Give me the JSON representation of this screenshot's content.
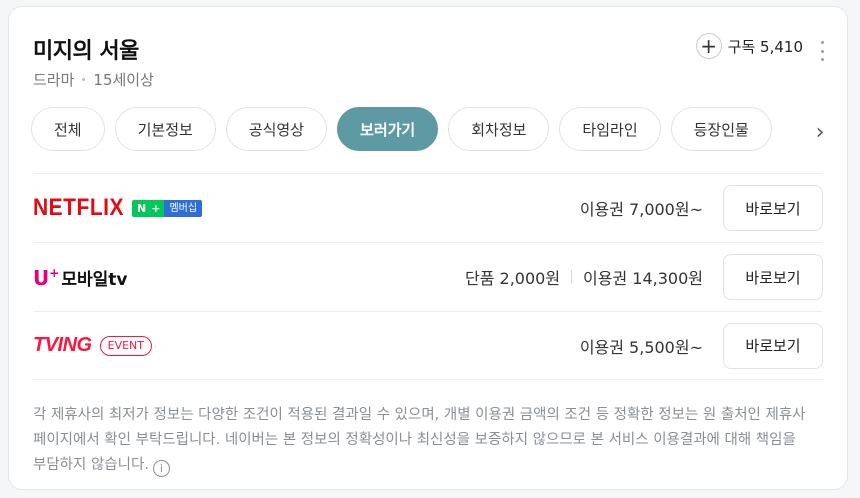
{
  "header": {
    "title": "미지의 서울",
    "genre": "드라마",
    "rating": "15세이상",
    "subscribe_label": "구독 5,410",
    "plus_glyph": "+"
  },
  "tabs": [
    {
      "label": "전체",
      "active": false
    },
    {
      "label": "기본정보",
      "active": false
    },
    {
      "label": "공식영상",
      "active": false
    },
    {
      "label": "보러가기",
      "active": true
    },
    {
      "label": "회차정보",
      "active": false
    },
    {
      "label": "타임라인",
      "active": false
    },
    {
      "label": "등장인물",
      "active": false
    }
  ],
  "providers": {
    "netflix": {
      "logo": "NETFLIX",
      "badge_n": "N",
      "badge_plus": "+",
      "badge_member": "멤버십",
      "price": "이용권 7,000원~",
      "button": "바로보기",
      "color": "#e50914"
    },
    "uplus": {
      "logo_u": "U",
      "logo_sup": "+",
      "logo_text": "모바일tv",
      "price_single": "단품 2,000원",
      "price_pass": "이용권 14,300원",
      "button": "바로보기",
      "color": "#e6007e"
    },
    "tving": {
      "logo": "TVING",
      "badge": "EVENT",
      "price": "이용권 5,500원~",
      "button": "바로보기",
      "color": "#ff153c"
    }
  },
  "notice": "각 제휴사의 최저가 정보는 다양한 조건이 적용된 결과일 수 있으며, 개별 이용권 금액의 조건 등 정확한 정보는 원 출처인 제휴사 페이지에서 확인 부탁드립니다. 네이버는 본 정보의 정확성이나 최신성을 보증하지 않으므로 본 서비스 이용결과에 대해 책임을 부담하지 않습니다.",
  "icons": {
    "info": "info-icon",
    "next": "chevron-right-icon",
    "more": "more-vertical-icon",
    "accent": "#5d9aa3"
  }
}
